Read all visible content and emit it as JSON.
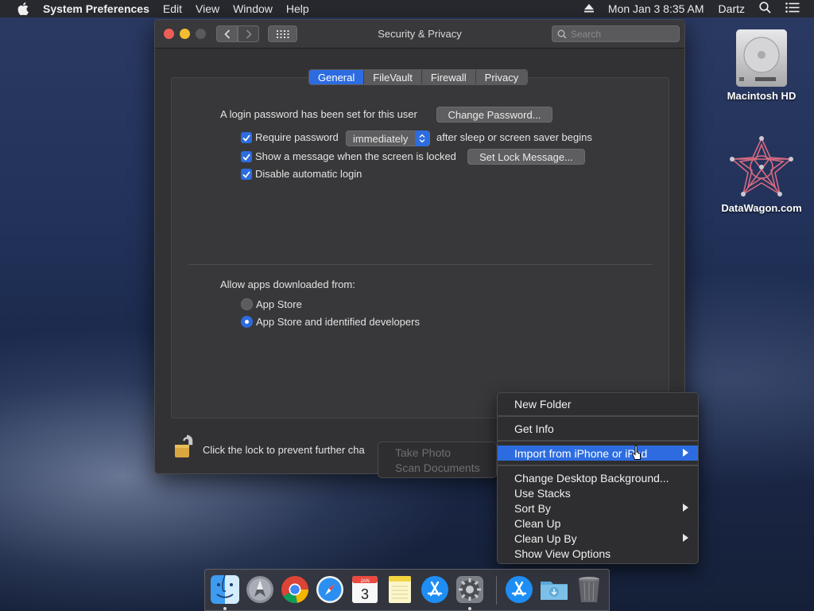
{
  "menubar": {
    "app_name": "System Preferences",
    "menus": [
      "Edit",
      "View",
      "Window",
      "Help"
    ],
    "clock": "Mon Jan 3  8:35 AM",
    "user": "Dartz"
  },
  "window": {
    "title": "Security & Privacy",
    "search_placeholder": "Search",
    "tabs": [
      {
        "label": "General",
        "active": true
      },
      {
        "label": "FileVault",
        "active": false
      },
      {
        "label": "Firewall",
        "active": false
      },
      {
        "label": "Privacy",
        "active": false
      }
    ],
    "general": {
      "password_text": "A login password has been set for this user",
      "change_password_button": "Change Password...",
      "require_password": {
        "label": "Require password",
        "checked": true,
        "value": "immediately",
        "suffix": "after sleep or screen saver begins"
      },
      "show_message": {
        "label": "Show a message when the screen is locked",
        "checked": true,
        "button": "Set Lock Message..."
      },
      "disable_autologin": {
        "label": "Disable automatic login",
        "checked": true
      },
      "allow_apps_label": "Allow apps downloaded from:",
      "options": [
        {
          "label": "App Store",
          "selected": false
        },
        {
          "label": "App Store and identified developers",
          "selected": true
        }
      ]
    },
    "lock_text": "Click the lock to prevent further cha"
  },
  "desktop_icons": [
    {
      "label": "Macintosh HD",
      "icon": "hard-drive-icon"
    },
    {
      "label": "DataWagon.com",
      "icon": "datawagon-logo-icon"
    }
  ],
  "context_menu": {
    "items": [
      {
        "label": "New Folder",
        "submenu": false,
        "highlighted": false
      },
      {
        "label": "Get Info",
        "submenu": false,
        "highlighted": false
      },
      {
        "label": "Import from iPhone or iPad",
        "submenu": true,
        "highlighted": true
      },
      {
        "label": "Change Desktop Background...",
        "submenu": false,
        "highlighted": false
      },
      {
        "label": "Use Stacks",
        "submenu": false,
        "highlighted": false
      },
      {
        "label": "Sort By",
        "submenu": true,
        "highlighted": false
      },
      {
        "label": "Clean Up",
        "submenu": false,
        "highlighted": false
      },
      {
        "label": "Clean Up By",
        "submenu": true,
        "highlighted": false
      },
      {
        "label": "Show View Options",
        "submenu": false,
        "highlighted": false
      }
    ]
  },
  "submenu": {
    "items": [
      "Take Photo",
      "Scan Documents"
    ]
  },
  "dock": {
    "apps": [
      "finder-icon",
      "launchpad-icon",
      "chrome-icon",
      "safari-icon",
      "calendar-icon",
      "notes-icon",
      "app-store-icon",
      "system-preferences-icon",
      "app-store-downloads-icon",
      "downloads-folder-icon",
      "trash-icon"
    ],
    "calendar_month": "JAN",
    "calendar_day": "3"
  },
  "colors": {
    "accent": "#2d6ce0",
    "window_bg": "#323234",
    "menu_bg": "#2e2e30"
  }
}
